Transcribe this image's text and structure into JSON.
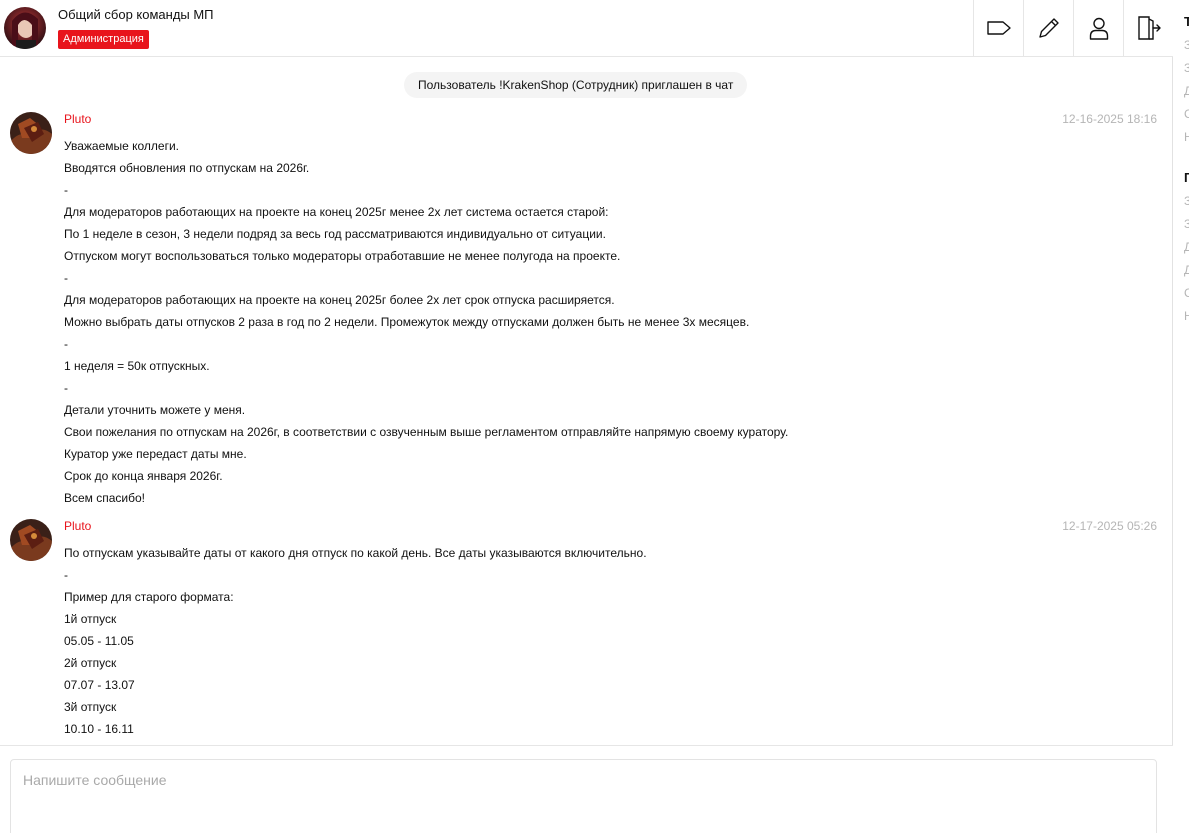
{
  "header": {
    "title": "Общий сбор команды МП",
    "badge": "Администрация"
  },
  "toolbar": {
    "tag_icon": "tag-icon",
    "edit_icon": "pencil-icon",
    "members_icon": "user-icon",
    "leave_icon": "exit-icon"
  },
  "system_message": "Пользователь !KrakenShop (Сотрудник) приглашен в чат",
  "messages": [
    {
      "author": "Pluto",
      "time": "12-16-2025 18:16",
      "lines": [
        "Уважаемые коллеги.",
        "Вводятся обновления по отпускам на 2026г.",
        "-",
        "Для модераторов работающих на проекте на конец 2025г менее 2х лет система остается старой:",
        "По 1 неделе в сезон, 3 недели подряд за весь год рассматриваются индивидуально от ситуации.",
        "Отпуском могут воспользоваться только модераторы отработавшие не менее полугода на проекте.",
        "-",
        "Для модераторов работающих на проекте на конец 2025г более 2х лет срок отпуска расширяется.",
        "Можно выбрать даты отпусков 2 раза в год по 2 недели. Промежуток между отпусками должен быть не менее 3х месяцев.",
        "-",
        "1 неделя = 50к отпускных.",
        "-",
        "Детали уточнить можете у меня.",
        "Свои пожелания по отпускам на 2026г, в соответствии с озвученным выше регламентом отправляйте напрямую своему куратору.",
        "Куратор уже передаст даты мне.",
        "Срок до конца января 2026г.",
        "Всем спасибо!"
      ]
    },
    {
      "author": "Pluto",
      "time": "12-17-2025 05:26",
      "lines": [
        "По отпускам указывайте даты от какого дня отпуск по какой день. Все даты указываются включительно.",
        "-",
        "Пример для старого формата:",
        "1й отпуск",
        "05.05 - 11.05",
        "2й отпуск",
        "07.07 - 13.07",
        "3й отпуск",
        "10.10 - 16.11"
      ]
    }
  ],
  "composer": {
    "placeholder": "Напишите сообщение"
  },
  "side": {
    "title_1": "Т",
    "lines_1": [
      "З",
      "З",
      "Д",
      "С",
      "Н"
    ],
    "title_2": "П",
    "lines_2": [
      "З",
      "З",
      "Д",
      "Д",
      "С",
      "Н"
    ]
  },
  "colors": {
    "accent": "#e8141c",
    "muted": "#b5b5b5",
    "system_bg": "#f4f4f4"
  }
}
